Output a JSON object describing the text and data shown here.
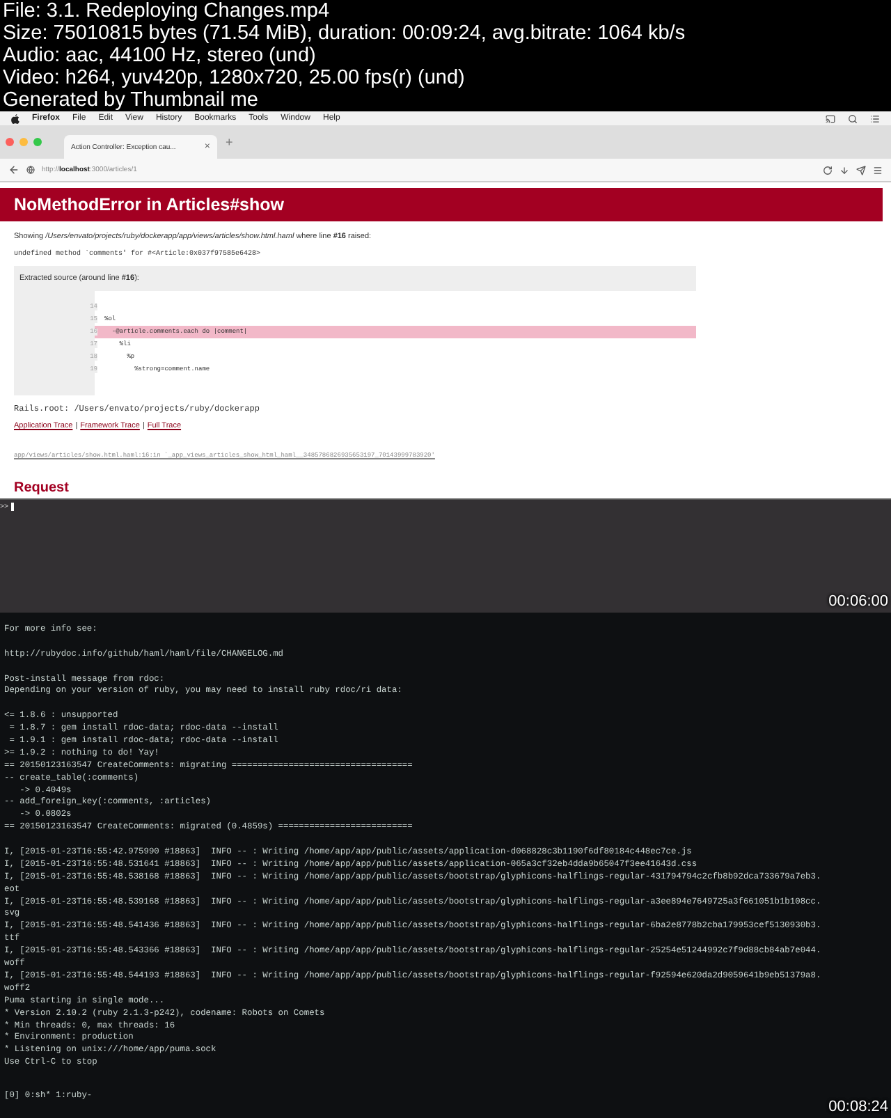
{
  "file_info": [
    "File: 3.1. Redeploying Changes.mp4",
    "Size: 75010815 bytes (71.54 MiB), duration: 00:09:24, avg.bitrate: 1064 kb/s",
    "Audio: aac, 44100 Hz, stereo (und)",
    "Video: h264, yuv420p, 1280x720, 25.00 fps(r) (und)",
    "Generated by Thumbnail me"
  ],
  "frames": [
    {
      "kind": "browser",
      "timestamp": "00:06:00",
      "menu_bar": {
        "app": "Firefox",
        "items": [
          "File",
          "Edit",
          "View",
          "History",
          "Bookmarks",
          "Tools",
          "Window",
          "Help"
        ]
      },
      "tab": {
        "title": "Action Controller: Exception cau...",
        "close": "×",
        "new_tab": "+"
      },
      "url": "http://**localhost**:3000/articles/1",
      "page": {
        "title": "NoMethodError in Articles#show",
        "showing": "Showing */Users/envato/projects/ruby/dockerapp/app/views/articles/show.html.haml* where line **#16** raised:",
        "message": "undefined method `comments' for #<Article:0x037f97585e6428>",
        "source_heading": "Extracted source (around line **#16**):",
        "source_lines": [
          {
            "number": "14",
            "highlighted": false
          },
          {
            "number": "15",
            "code": "%ol",
            "highlighted": false
          },
          {
            "number": "16",
            "code": "  -@article.comments.each do |comment|",
            "highlighted": true
          },
          {
            "number": "17",
            "code": "    %li",
            "highlighted": false
          },
          {
            "number": "18",
            "code": "      %p",
            "highlighted": false
          },
          {
            "number": "19",
            "code": "        %strong=comment.name",
            "highlighted": false
          }
        ],
        "rails_root": "Rails.root: /Users/envato/projects/ruby/dockerapp",
        "trace_links": [
          "Application Trace",
          "Framework Trace",
          "Full Trace"
        ],
        "trace_separator": "|",
        "trace_line": "app/views/articles/show.html.haml:16:in `_app_views_articles_show_html_haml__3485786826935653197_70143999783920'",
        "section_heading": "Request"
      },
      "console_prompt": ">>"
    },
    {
      "kind": "terminal",
      "timestamp": "00:08:24",
      "blocks": [
        [
          "For more info see:"
        ],
        [
          "http://rubydoc.info/github/haml/haml/file/CHANGELOG.md"
        ],
        [
          "Post-install message from rdoc:",
          "Depending on your version of ruby, you may need to install ruby rdoc/ri data:"
        ],
        [
          "<= 1.8.6 : unsupported",
          " = 1.8.7 : gem install rdoc-data; rdoc-data --install",
          " = 1.9.1 : gem install rdoc-data; rdoc-data --install",
          ">= 1.9.2 : nothing to do! Yay!",
          "== 20150123163547 CreateComments: migrating ===================================",
          "-- create_table(:comments)",
          "   -> 0.4049s",
          "-- add_foreign_key(:comments, :articles)",
          "   -> 0.0802s",
          "== 20150123163547 CreateComments: migrated (0.4859s) =========================="
        ],
        [
          "I, [2015-01-23T16:55:42.975990 #18863]  INFO -- : Writing /home/app/app/public/assets/application-d068828c3b1190f6df80184c448ec7ce.js",
          "I, [2015-01-23T16:55:48.531641 #18863]  INFO -- : Writing /home/app/app/public/assets/application-065a3cf32eb4dda9b65047f3ee41643d.css",
          "I, [2015-01-23T16:55:48.538168 #18863]  INFO -- : Writing /home/app/app/public/assets/bootstrap/glyphicons-halflings-regular-431794794c2cfb8b92dca733679a7eb3.",
          "eot",
          "I, [2015-01-23T16:55:48.539168 #18863]  INFO -- : Writing /home/app/app/public/assets/bootstrap/glyphicons-halflings-regular-a3ee894e7649725a3f661051b1b108cc.",
          "svg",
          "I, [2015-01-23T16:55:48.541436 #18863]  INFO -- : Writing /home/app/app/public/assets/bootstrap/glyphicons-halflings-regular-6ba2e8778b2cba179953cef5130930b3.",
          "ttf",
          "I, [2015-01-23T16:55:48.543366 #18863]  INFO -- : Writing /home/app/app/public/assets/bootstrap/glyphicons-halflings-regular-25254e51244992c7f9d88cb84ab7e044.",
          "woff",
          "I, [2015-01-23T16:55:48.544193 #18863]  INFO -- : Writing /home/app/app/public/assets/bootstrap/glyphicons-halflings-regular-f92594e620da2d9059641b9eb51379a8.",
          "woff2",
          "Puma starting in single mode...",
          "* Version 2.10.2 (ruby 2.1.3-p242), codename: Robots on Comets",
          "* Min threads: 0, max threads: 16",
          "* Environment: production",
          "* Listening on unix:///home/app/puma.sock",
          "Use Ctrl-C to stop"
        ]
      ],
      "status_line": "[0] 0:sh* 1:ruby-"
    }
  ]
}
